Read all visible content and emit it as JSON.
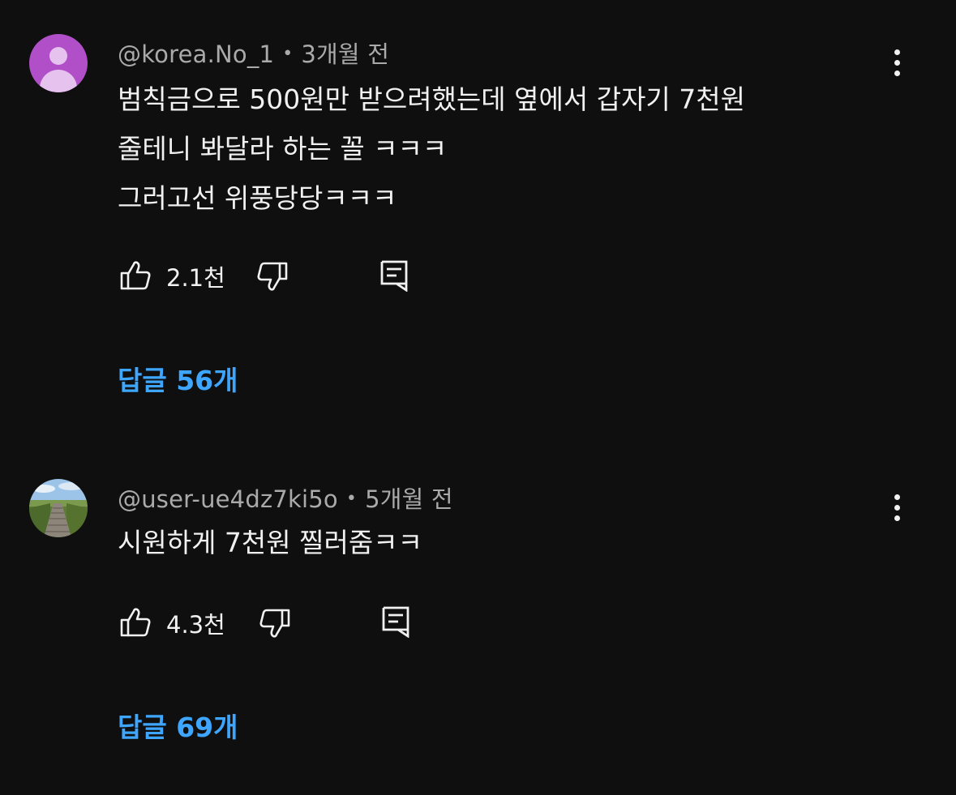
{
  "comments": [
    {
      "author": "@korea.No_1",
      "separator": "•",
      "time": "3개월 전",
      "lines": [
        "범칙금으로 500원만 받으려했는데 옆에서 갑자기 7천원",
        "줄테니 봐달라 하는 꼴 ㅋㅋㅋ",
        "그러고선 위풍당당ㅋㅋㅋ"
      ],
      "likes": "2.1천",
      "replies": "답글 56개",
      "avatar": "default-user-avatar",
      "avatar_color": "#b14fc9"
    },
    {
      "author": "@user-ue4dz7ki5o",
      "separator": "•",
      "time": "5개월 전",
      "lines": [
        "시원하게 7천원 찔러줌ㅋㅋ"
      ],
      "likes": "4.3천",
      "replies": "답글 69개",
      "avatar": "landscape-photo-avatar"
    }
  ],
  "colors": {
    "background": "#0f0f0f",
    "text": "#f1f1f1",
    "meta": "#aaaaaa",
    "link": "#3ea6ff"
  },
  "icons": {
    "like": "thumbs-up-icon",
    "dislike": "thumbs-down-icon",
    "reply": "comment-reply-icon",
    "menu": "more-vertical-icon"
  }
}
